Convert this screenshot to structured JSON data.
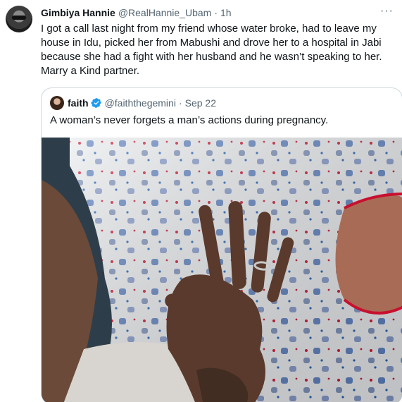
{
  "tweet": {
    "author_name": "Gimbiya Hannie",
    "author_handle": "@RealHannie_Ubam",
    "separator": "·",
    "time": "1h",
    "more_icon": "more-horizontal-icon",
    "text": "I got a call last night from my friend whose water broke, had to leave my house in Idu, picked her from Mabushi and drove her to a hospital in Jabi because she had a fight with her husband and he wasn’t speaking to her. Marry a Kind partner."
  },
  "quoted_tweet": {
    "author_name": "faith",
    "author_handle": "@faiththegemini",
    "separator": "·",
    "time": "Sep 22",
    "verified_icon": "verified-badge-icon",
    "text": "A woman’s never forgets a man’s actions during pregnancy.",
    "media": {
      "description_icon": "photo",
      "colors": {
        "fabric": "#e9ebee",
        "skin": "#6b4a39",
        "trim": "#c8102e"
      }
    }
  },
  "colors": {
    "text_primary": "#0f1419",
    "text_secondary": "#536471",
    "border": "#cfd9de",
    "verified_blue": "#1d9bf0"
  }
}
